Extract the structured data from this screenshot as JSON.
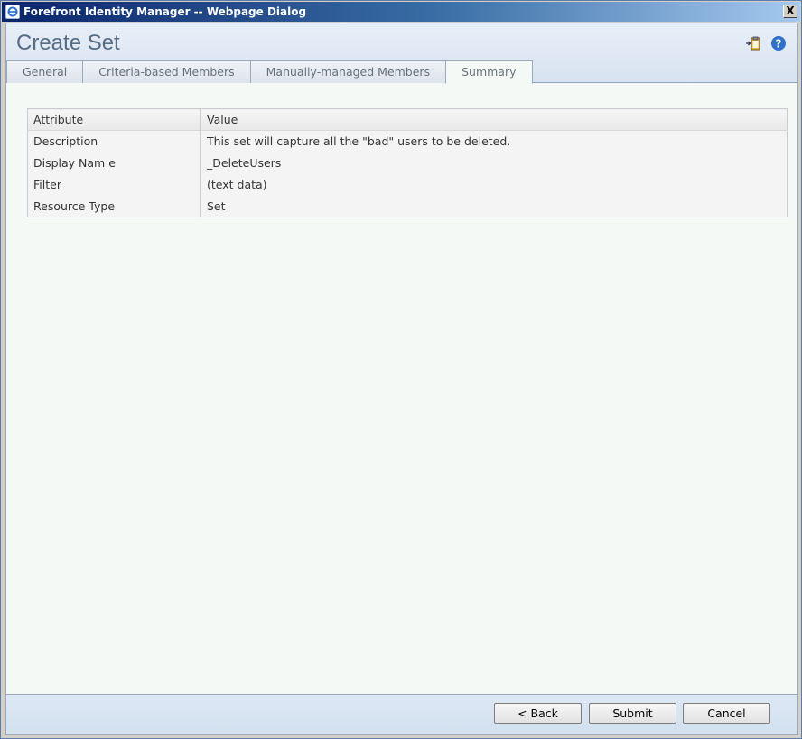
{
  "window": {
    "title": "Forefront Identity Manager -- Webpage Dialog",
    "close_label": "X"
  },
  "header": {
    "title": "Create Set",
    "icons": [
      "clipboard-arrow-icon",
      "help-icon"
    ]
  },
  "tabs": [
    {
      "label": "General"
    },
    {
      "label": "Criteria-based Members"
    },
    {
      "label": "Manually-managed Members"
    },
    {
      "label": "Summary",
      "active": true
    }
  ],
  "summary_table": {
    "headers": [
      "Attribute",
      "Value"
    ],
    "rows": [
      [
        "Description",
        "This set will capture all the \"bad\" users to be deleted."
      ],
      [
        "Display Nam e",
        "_DeleteUsers"
      ],
      [
        "Filter",
        "(text data)"
      ],
      [
        "Resource Type",
        "Set"
      ]
    ]
  },
  "footer": {
    "back_label": "< Back",
    "submit_label": "Submit",
    "cancel_label": "Cancel"
  }
}
